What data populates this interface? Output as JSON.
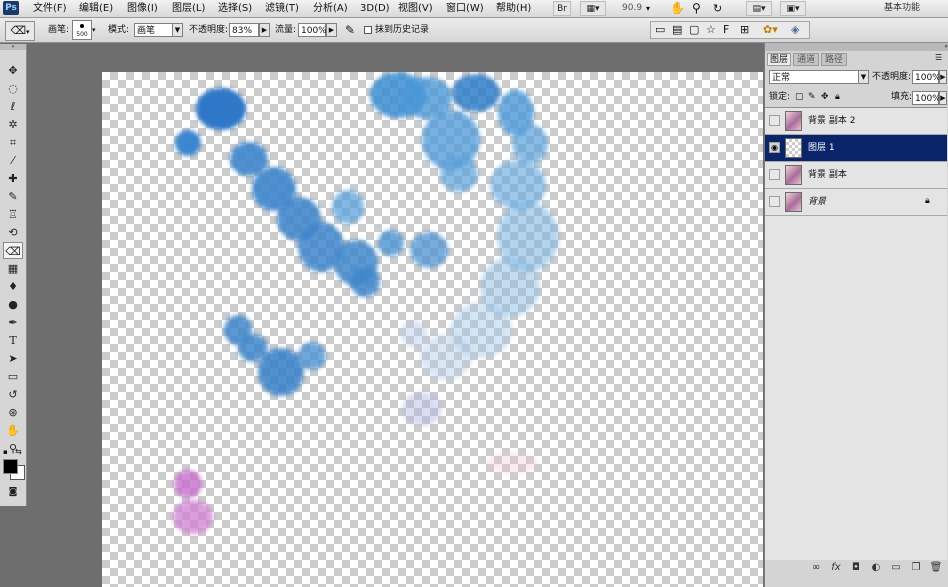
{
  "app": {
    "logo": "Ps"
  },
  "menu": {
    "items": [
      "文件(F)",
      "编辑(E)",
      "图像(I)",
      "图层(L)",
      "选择(S)",
      "滤镜(T)",
      "分析(A)",
      "3D(D)",
      "视图(V)",
      "窗口(W)",
      "帮助(H)"
    ],
    "bridge": "Br",
    "zoom": "90.9",
    "workspace": "基本功能"
  },
  "options": {
    "brush_label": "画笔:",
    "brush_size": "500",
    "mode_label": "模式:",
    "mode_value": "画笔",
    "opacity_label": "不透明度:",
    "opacity_value": "83%",
    "flow_label": "流量:",
    "flow_value": "100%",
    "erase_history": "抹到历史记录"
  },
  "tools": [
    "move-tool",
    "marquee-tool",
    "lasso-tool",
    "quick-select-tool",
    "crop-tool",
    "eyedropper-tool",
    "healing-tool",
    "brush-tool",
    "clone-stamp-tool",
    "history-brush-tool",
    "eraser-tool",
    "gradient-tool",
    "blur-tool",
    "dodge-tool",
    "pen-tool",
    "type-tool",
    "path-select-tool",
    "shape-tool",
    "3d-rotate-tool",
    "3d-orbit-tool",
    "hand-tool",
    "zoom-tool"
  ],
  "colors": {
    "foreground": "#000000",
    "background": "#ffffff",
    "selection": "#0a246a"
  },
  "panel": {
    "tabs": [
      "图层",
      "通道",
      "路径"
    ],
    "blend_mode": "正常",
    "opacity_label": "不透明度:",
    "opacity_value": "100%",
    "lock_label": "锁定:",
    "fill_label": "填充:",
    "fill_value": "100%",
    "layers": [
      {
        "name": "背景 副本 2",
        "visible": false,
        "selected": false
      },
      {
        "name": "图层 1",
        "visible": true,
        "selected": true
      },
      {
        "name": "背景 副本",
        "visible": false,
        "selected": false
      },
      {
        "name": "背景",
        "visible": false,
        "selected": false,
        "locked": true
      }
    ]
  }
}
